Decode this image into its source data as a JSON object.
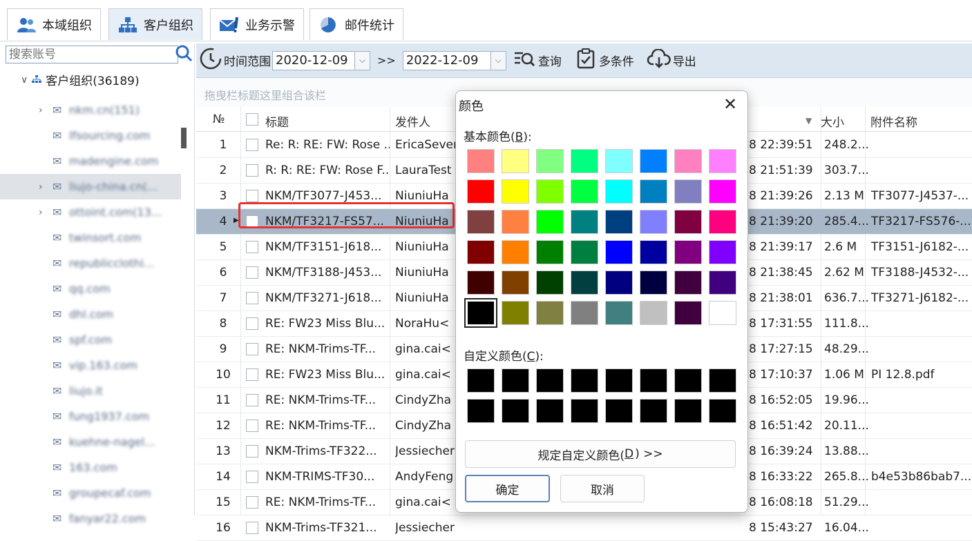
{
  "tabs": [
    {
      "label": "本域组织",
      "icon": "users-icon"
    },
    {
      "label": "客户组织",
      "icon": "org-chart-icon"
    },
    {
      "label": "业务示警",
      "icon": "alert-mail-icon"
    },
    {
      "label": "邮件统计",
      "icon": "pie-chart-icon"
    }
  ],
  "sidebar": {
    "search_placeholder": "搜索账号",
    "root_label": "客户组织(36189)",
    "items": [
      {
        "label": "nkm.cn(151)",
        "arrow": true
      },
      {
        "label": "lfsourcing.com",
        "arrow": false
      },
      {
        "label": "madengine.com",
        "arrow": false
      },
      {
        "label": "liujo-china.cn(...",
        "arrow": true,
        "selected": true
      },
      {
        "label": "ottoint.com(13...",
        "arrow": true
      },
      {
        "label": "twinsort.com",
        "arrow": false
      },
      {
        "label": "republicclothi...",
        "arrow": false
      },
      {
        "label": "qq.com",
        "arrow": false
      },
      {
        "label": "dhl.com",
        "arrow": false
      },
      {
        "label": "spf.com",
        "arrow": false
      },
      {
        "label": "vip.163.com",
        "arrow": false
      },
      {
        "label": "liujo.it",
        "arrow": false
      },
      {
        "label": "fung1937.com",
        "arrow": false
      },
      {
        "label": "kuehne-nagel...",
        "arrow": false
      },
      {
        "label": "163.com",
        "arrow": false
      },
      {
        "label": "groupecaf.com",
        "arrow": false
      },
      {
        "label": "fanyar22.com",
        "arrow": false
      }
    ]
  },
  "toolbar": {
    "range_label": "时间范围",
    "start_date": "2020-12-09",
    "sep": ">>",
    "end_date": "2022-12-09",
    "query_label": "查询",
    "multi_label": "多条件",
    "export_label": "导出"
  },
  "group_hint": "拖曳栏标题这里组合该栏",
  "grid": {
    "headers": {
      "no": "№",
      "title": "标题",
      "sender": "发件人",
      "size": "大小",
      "attach": "附件名称"
    },
    "rows": [
      {
        "no": "1",
        "title": "Re: R: RE: FW: Rose ...",
        "sender": "EricaSever",
        "time": "8 22:39:51",
        "size": "248.2...",
        "attach": ""
      },
      {
        "no": "2",
        "title": "R: R: RE: FW: Rose F...",
        "sender": "LauraTest",
        "time": "8 21:51:39",
        "size": "303.7...",
        "attach": ""
      },
      {
        "no": "3",
        "title": "NKM/TF3077-J453...",
        "sender": "NiuniuHa",
        "time": "8 21:39:26",
        "size": "2.13 M",
        "attach": "TF3077-J4537-..."
      },
      {
        "no": "4",
        "title": "NKM/TF3217-FS57...",
        "sender": "NiuniuHa",
        "time": "8 21:39:20",
        "size": "285.4...",
        "attach": "TF3217-FS576-...",
        "selected": true
      },
      {
        "no": "5",
        "title": "NKM/TF3151-J618...",
        "sender": "NiuniuHa",
        "time": "8 21:39:17",
        "size": "2.6 M",
        "attach": "TF3151-J6182-..."
      },
      {
        "no": "6",
        "title": "NKM/TF3188-J453...",
        "sender": "NiuniuHa",
        "time": "8 21:38:45",
        "size": "2.62 M",
        "attach": "TF3188-J4532-..."
      },
      {
        "no": "7",
        "title": "NKM/TF3271-J618...",
        "sender": "NiuniuHa",
        "time": "8 21:38:01",
        "size": "636.7...",
        "attach": "TF3271-J6182-..."
      },
      {
        "no": "8",
        "title": "RE: FW23 Miss Blu...",
        "sender": "NoraHu<",
        "time": "8 17:31:55",
        "size": "111.8...",
        "attach": ""
      },
      {
        "no": "9",
        "title": "RE: NKM-Trims-TF...",
        "sender": "gina.cai<",
        "time": "8 17:27:15",
        "size": "48.29...",
        "attach": ""
      },
      {
        "no": "10",
        "title": "RE: FW23 Miss Blu...",
        "sender": "gina.cai<",
        "time": "8 17:10:37",
        "size": "1.06 M",
        "attach": "PI 12.8.pdf"
      },
      {
        "no": "11",
        "title": "RE: NKM-Trims-TF...",
        "sender": "CindyZha",
        "time": "8 16:52:05",
        "size": "19.96...",
        "attach": ""
      },
      {
        "no": "12",
        "title": "RE: NKM-Trims-TF...",
        "sender": "CindyZha",
        "time": "8 16:51:42",
        "size": "20.11...",
        "attach": ""
      },
      {
        "no": "13",
        "title": "NKM-Trims-TF322...",
        "sender": "Jessiecher",
        "time": "8 16:39:24",
        "size": "13.88...",
        "attach": ""
      },
      {
        "no": "14",
        "title": "NKM-TRIMS-TF30...",
        "sender": "AndyFeng",
        "time": "8 16:33:22",
        "size": "265.8...",
        "attach": "b4e53b86bab7..."
      },
      {
        "no": "15",
        "title": "RE: NKM-Trims-TF...",
        "sender": "gina.cai<",
        "time": "8 16:08:18",
        "size": "51.29...",
        "attach": ""
      },
      {
        "no": "16",
        "title": "NKM-Trims-TF321...",
        "sender": "Jessiecher",
        "time": "8 15:43:27",
        "size": "16.04...",
        "attach": ""
      }
    ]
  },
  "dialog": {
    "title": "颜色",
    "basic_label_pre": "基本颜色(",
    "basic_key": "B",
    "basic_label_post": "):",
    "custom_label_pre": "自定义颜色(",
    "custom_key": "C",
    "custom_label_post": "):",
    "define_pre": "规定自定义颜色(",
    "define_key": "D",
    "define_post": ") >>",
    "ok_label": "确定",
    "cancel_label": "取消",
    "basic_colors": [
      "#FF8080",
      "#FFFF80",
      "#80FF80",
      "#00FF80",
      "#80FFFF",
      "#0080FF",
      "#FF80C0",
      "#FF80FF",
      "#FF0000",
      "#FFFF00",
      "#80FF00",
      "#00FF40",
      "#00FFFF",
      "#0080C0",
      "#8080C0",
      "#FF00FF",
      "#804040",
      "#FF8040",
      "#00FF00",
      "#008080",
      "#004080",
      "#8080FF",
      "#800040",
      "#FF0080",
      "#800000",
      "#FF8000",
      "#008000",
      "#008040",
      "#0000FF",
      "#0000A0",
      "#800080",
      "#8000FF",
      "#400000",
      "#804000",
      "#004000",
      "#004040",
      "#000080",
      "#000040",
      "#400040",
      "#400080",
      "#000000",
      "#808000",
      "#808040",
      "#808080",
      "#408080",
      "#C0C0C0",
      "#400040",
      "#FFFFFF"
    ],
    "selected_index": 40,
    "custom_color": "#000000"
  }
}
